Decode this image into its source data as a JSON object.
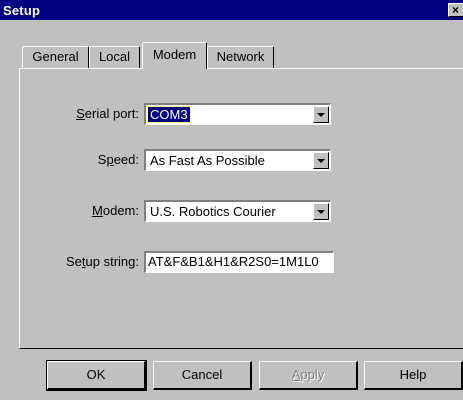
{
  "window": {
    "title": "Setup",
    "close_glyph": "×"
  },
  "tabs": [
    {
      "label": "General",
      "active": false
    },
    {
      "label": "Local",
      "active": false
    },
    {
      "label": "Modem",
      "active": true
    },
    {
      "label": "Network",
      "active": false
    }
  ],
  "form": {
    "serial_port": {
      "label_key": "S",
      "label_rest": "erial port:",
      "value": "COM3"
    },
    "speed": {
      "label_pre": "S",
      "label_key": "p",
      "label_rest": "eed:",
      "value": "As Fast As Possible"
    },
    "modem": {
      "label_key": "M",
      "label_rest": "odem:",
      "value": "U.S. Robotics Courier"
    },
    "setup_string": {
      "label_pre": "Se",
      "label_key": "t",
      "label_rest": "up string:",
      "value": "AT&F&B1&H1&R2S0=1M1L0"
    }
  },
  "buttons": {
    "ok": "OK",
    "cancel": "Cancel",
    "apply_key": "A",
    "apply_rest": "pply",
    "help": "Help"
  },
  "colors": {
    "titlebar": "#000080",
    "face": "#c0c0c0",
    "selection": "#000080"
  }
}
